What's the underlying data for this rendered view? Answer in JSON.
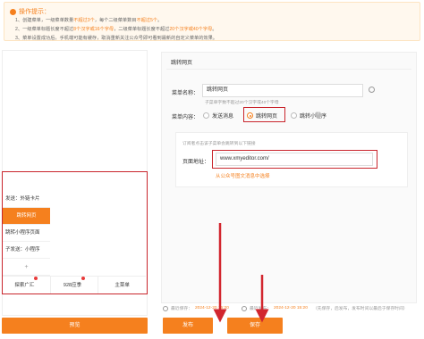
{
  "tips": {
    "title": "操作提示：",
    "lines": [
      {
        "pre": "1、创建菜单，一级菜单数量",
        "hl1": "不超过3个",
        "mid": "，每个二级菜单数目",
        "hl2": "不超过5个",
        "post": "。"
      },
      {
        "pre": "2、一级菜单标题长度不超过",
        "hl1": "8个汉字或16个字母",
        "mid": "，二级菜单标题长度不超过",
        "hl2": "20个汉字或40个字母",
        "post": "。"
      },
      {
        "pre": "3、菜单设置成功后，手机端可能有缓存，取消重新关注公众号即可看到最新的自定义菜单的效果。",
        "hl1": "",
        "mid": "",
        "hl2": "",
        "post": ""
      }
    ]
  },
  "menu": {
    "items": [
      {
        "label": "发送：外链卡片",
        "active": false
      },
      {
        "label": "跳转网页",
        "active": true
      },
      {
        "label": "跳转小程序页面",
        "active": false
      },
      {
        "label": "子发送：小程序",
        "active": false
      }
    ],
    "add": "+",
    "tabs": [
      "探索广汇",
      "928应季",
      "主菜单"
    ]
  },
  "edit": {
    "title": "跳转网页",
    "name_label": "菜单名称：",
    "name_value": "跳转网页",
    "name_hint": "子菜单字数不超过20个汉字或40个字母",
    "content_label": "菜单内容：",
    "radios": [
      {
        "label": "发送消息",
        "on": false
      },
      {
        "label": "跳转网页",
        "on": true
      },
      {
        "label": "跳转小程序",
        "on": false
      }
    ],
    "qmark": "?",
    "sub_hint": "订阅者点击该子菜单会跳转到以下链接",
    "url_label": "页面地址：",
    "url_value": "www.xmyeditor.com/",
    "link_text": "从公众号图文消息中选择"
  },
  "status": {
    "left_pre": "最近保存：",
    "left_date": "2024-12-20 15:20",
    "mid_pre": "最近发布：",
    "mid_date": "2024-12-20 15:20",
    "right": "（先保存，后发布，发布时间以最后于保存时间）"
  },
  "buttons": {
    "preview": "预览",
    "publish": "发布",
    "save": "保存"
  },
  "colors": {
    "accent": "#f5801e",
    "highlight_border": "#c9252c"
  }
}
